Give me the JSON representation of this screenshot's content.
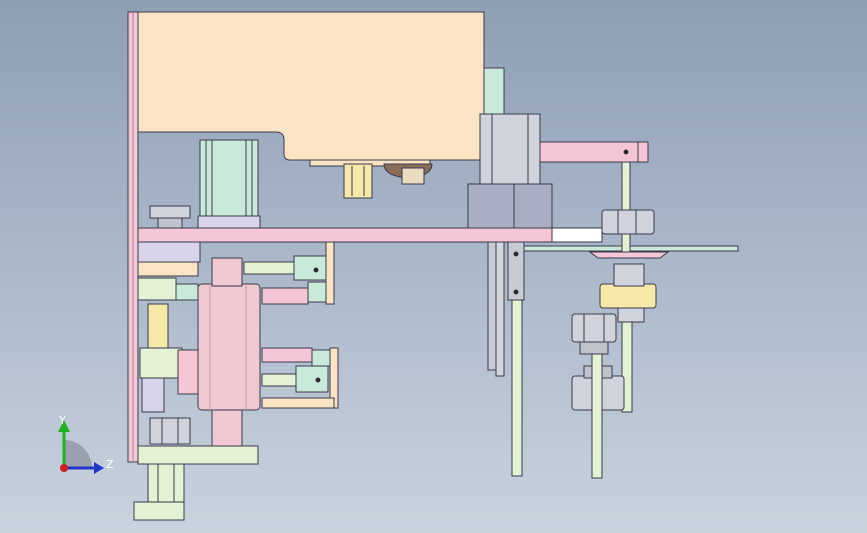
{
  "viewport": {
    "background_top": "#8e9fb4",
    "background_bottom": "#c9d3de"
  },
  "triad": {
    "y_label": "Y",
    "z_label": "Z",
    "y_color": "#22b022",
    "z_color": "#2233cc",
    "x_color": "#d02020"
  },
  "palette": {
    "housing": "#fbe4c4",
    "frame": "#f4c6d6",
    "motor": "#c9eadb",
    "cylinder": "#f0c8d2",
    "pale_green": "#e4f2d4",
    "lavender": "#d8d4ec",
    "steel": "#c8cad4",
    "block": "#a9aec4",
    "edge": "#3a3a4a"
  }
}
